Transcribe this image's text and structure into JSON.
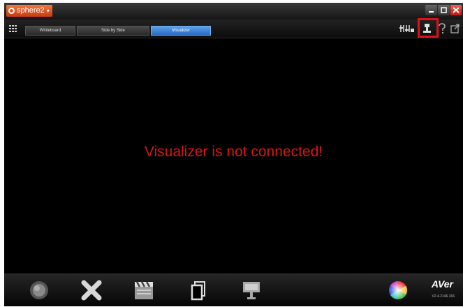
{
  "app": {
    "name": "sphere2"
  },
  "tabs": [
    {
      "label": "Whiteboard",
      "active": false
    },
    {
      "label": "Side by Side",
      "active": false
    },
    {
      "label": "Visualizer",
      "active": true
    }
  ],
  "toolbar_icons": [
    "settings-sliders-icon",
    "camera-connect-icon",
    "help-icon",
    "export-icon"
  ],
  "main": {
    "message": "Visualizer is not connected!"
  },
  "bottom_icons": [
    "record-icon",
    "close-x-icon",
    "clapperboard-icon",
    "file-copy-icon",
    "presentation-icon",
    "color-wheel-icon"
  ],
  "brand": {
    "logo": "AVer",
    "version": "V2.4.2146.166"
  },
  "colors": {
    "message": "#d41818",
    "active_tab": "#2a6cc2",
    "highlight": "#e0101a",
    "app_badge": "#e0602a"
  }
}
